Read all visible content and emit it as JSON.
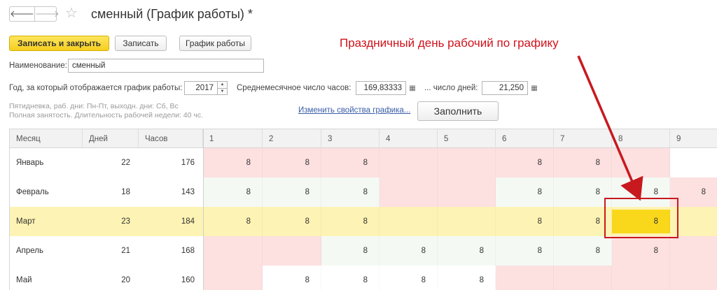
{
  "window": {
    "title": "сменный (График работы) *",
    "back_glyph": "🡐",
    "forward_glyph": "🡒",
    "favorite_glyph": "☆"
  },
  "toolbar": {
    "save_close": "Записать и закрыть",
    "save": "Записать",
    "schedule": "График работы"
  },
  "form": {
    "name_label": "Наименование:",
    "name_value": "сменный",
    "year_label": "Год, за который отображается график работы:",
    "year_value": "2017",
    "avg_hours_label": "Среднемесячное число часов:",
    "avg_hours_value": "169,83333",
    "days_label": "... число дней:",
    "days_value": "21,250",
    "info_line1": "Пятидневка, раб. дни: Пн-Пт, выходн. дни: Сб, Вс",
    "info_line2": "Полная занятость. Длительность рабочей недели: 40 чс.",
    "change_link": "Изменить свойства графика...",
    "fill_button": "Заполнить"
  },
  "annotation": "Праздничный день рабочий по графику",
  "colors": {
    "off_day": "#fde0e0",
    "work_day_white": "#ffffff",
    "work_day_green": "#f4f9f4",
    "selected_row": "#fdf3b4",
    "selected_cell": "#f9d81c",
    "annotation": "#d0121b"
  },
  "table": {
    "headers": [
      "Месяц",
      "Дней",
      "Часов",
      "1",
      "2",
      "3",
      "4",
      "5",
      "6",
      "7",
      "8",
      "9"
    ],
    "rows": [
      {
        "month": "Январь",
        "days": "22",
        "hours": "176",
        "selected": false,
        "cells": [
          {
            "v": "8",
            "t": "off"
          },
          {
            "v": "8",
            "t": "off"
          },
          {
            "v": "8",
            "t": "off"
          },
          {
            "v": "",
            "t": "off"
          },
          {
            "v": "",
            "t": "off"
          },
          {
            "v": "8",
            "t": "off"
          },
          {
            "v": "8",
            "t": "off"
          },
          {
            "v": "",
            "t": "off"
          },
          {
            "v": "",
            "t": "work"
          }
        ]
      },
      {
        "month": "Февраль",
        "days": "18",
        "hours": "143",
        "selected": false,
        "cells": [
          {
            "v": "8",
            "t": "work"
          },
          {
            "v": "8",
            "t": "work"
          },
          {
            "v": "8",
            "t": "work"
          },
          {
            "v": "",
            "t": "off"
          },
          {
            "v": "",
            "t": "off"
          },
          {
            "v": "8",
            "t": "work"
          },
          {
            "v": "8",
            "t": "work"
          },
          {
            "v": "8",
            "t": "work"
          },
          {
            "v": "8",
            "t": "off"
          }
        ]
      },
      {
        "month": "Март",
        "days": "23",
        "hours": "184",
        "selected": true,
        "cells": [
          {
            "v": "8",
            "t": "work"
          },
          {
            "v": "8",
            "t": "work"
          },
          {
            "v": "8",
            "t": "work"
          },
          {
            "v": "",
            "t": "work"
          },
          {
            "v": "",
            "t": "work"
          },
          {
            "v": "8",
            "t": "work"
          },
          {
            "v": "8",
            "t": "work"
          },
          {
            "v": "8",
            "t": "current"
          },
          {
            "v": "",
            "t": "work"
          }
        ]
      },
      {
        "month": "Апрель",
        "days": "21",
        "hours": "168",
        "selected": false,
        "cells": [
          {
            "v": "",
            "t": "off"
          },
          {
            "v": "",
            "t": "off"
          },
          {
            "v": "8",
            "t": "work"
          },
          {
            "v": "8",
            "t": "work"
          },
          {
            "v": "8",
            "t": "work"
          },
          {
            "v": "8",
            "t": "work"
          },
          {
            "v": "8",
            "t": "work"
          },
          {
            "v": "8",
            "t": "off"
          },
          {
            "v": "",
            "t": "off"
          }
        ]
      },
      {
        "month": "Май",
        "days": "20",
        "hours": "160",
        "selected": false,
        "cells": [
          {
            "v": "",
            "t": "off"
          },
          {
            "v": "8",
            "t": "work"
          },
          {
            "v": "8",
            "t": "work"
          },
          {
            "v": "8",
            "t": "work"
          },
          {
            "v": "8",
            "t": "work"
          },
          {
            "v": "",
            "t": "off"
          },
          {
            "v": "",
            "t": "off"
          },
          {
            "v": "",
            "t": "off"
          },
          {
            "v": "",
            "t": "off"
          }
        ]
      }
    ]
  }
}
